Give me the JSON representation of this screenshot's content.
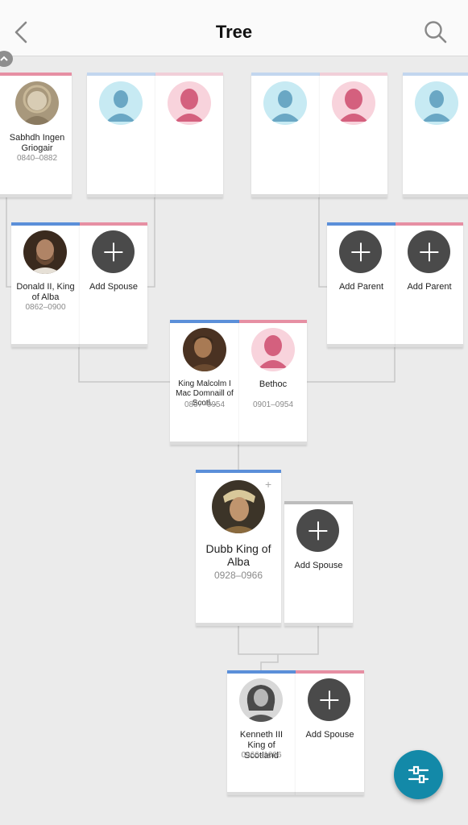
{
  "header": {
    "title": "Tree"
  },
  "people": {
    "sabhdh": {
      "name": "Sabhdh Ingen Griogair",
      "dates": "0840–0882"
    },
    "donald": {
      "name": "Donald II, King of Alba",
      "dates": "0862–0900"
    },
    "malcolm": {
      "name": "King Malcolm I Mac Domnaill of Scotl...",
      "dates": "0897–0954"
    },
    "bethoc": {
      "name": "Bethoc",
      "dates": "0901–0954"
    },
    "dubb": {
      "name": "Dubb King of Alba",
      "dates": "0928–0966"
    },
    "kenneth": {
      "name": "Kenneth III King of Scotland",
      "dates": "0966–1006"
    }
  },
  "actions": {
    "add_spouse": "Add Spouse",
    "add_parent": "Add Parent"
  },
  "colors": {
    "male_border": "#5b8fd9",
    "female_border": "#e68fa3",
    "fab": "#1389a8"
  },
  "icons": {
    "back": "chevron-left-icon",
    "search": "search-icon",
    "filter": "sliders-icon",
    "add": "plus-icon"
  }
}
